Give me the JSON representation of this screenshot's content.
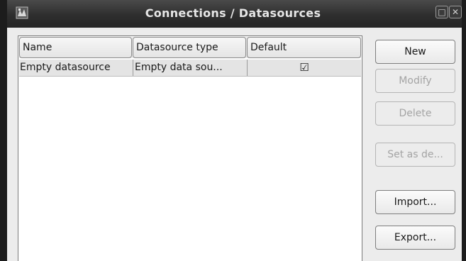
{
  "window": {
    "title": "Connections / Datasources",
    "controls": {
      "maximize": "□",
      "close": "✕"
    }
  },
  "table": {
    "columns": [
      "Name",
      "Datasource type",
      "Default"
    ],
    "rows": [
      {
        "name": "Empty datasource",
        "type": "Empty data sou...",
        "default_mark": "☑"
      }
    ]
  },
  "buttons": {
    "new": "New",
    "modify": "Modify",
    "delete": "Delete",
    "set_default": "Set as de...",
    "import": "Import...",
    "export": "Export..."
  },
  "colors": {
    "titlebar": "#2e2e2e",
    "window_bg": "#ececec",
    "selected_row": "#e4e4e4",
    "disabled_text": "#a4a4a4"
  }
}
